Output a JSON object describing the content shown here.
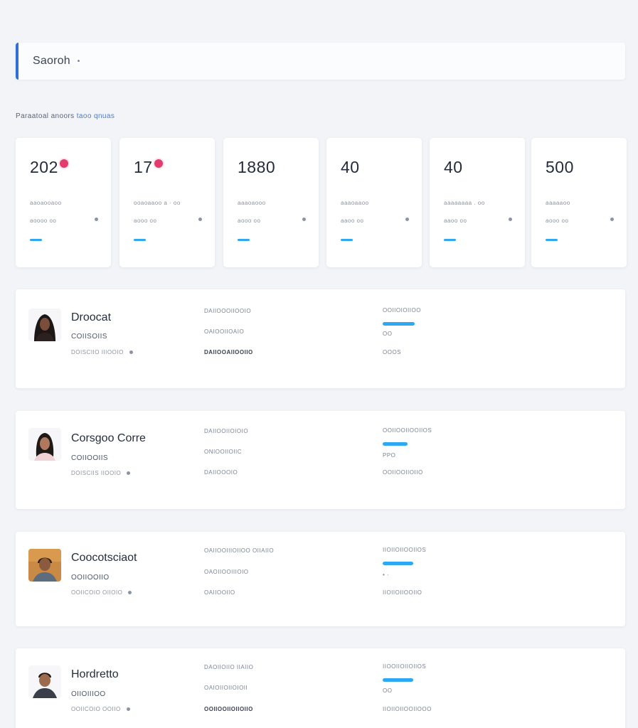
{
  "search": {
    "label": "Saoroh",
    "dot": "•"
  },
  "section": {
    "title_main": "Paraatoal anoors",
    "title_accent": "taoo qnuas"
  },
  "colors": {
    "accent_blue": "#2ea8f0",
    "badge_pink": "#e23c6f",
    "search_border": "#2f6fd6"
  },
  "stats": [
    {
      "value": "202",
      "caption": "aaoaooaoo",
      "sub": "aoooo oo",
      "bar_progress": 0.13,
      "badge": true
    },
    {
      "value": "17",
      "caption": "ooaoaaoo a · oo",
      "sub": "aooo oo",
      "bar_progress": 0.13,
      "badge": true
    },
    {
      "value": "1880",
      "caption": "aaaoaooo",
      "sub": "aooo oo",
      "bar_progress": 0.13,
      "badge": false
    },
    {
      "value": "40",
      "caption": "aaaoaaoo",
      "sub": "aaoo oo",
      "bar_progress": 0.13,
      "badge": false
    },
    {
      "value": "40",
      "caption": "aaaaaaaa . oo",
      "sub": "aaoo oo",
      "bar_progress": 0.13,
      "badge": false
    },
    {
      "value": "500",
      "caption": "aaaaaoo",
      "sub": "aooo oo",
      "bar_progress": 0.13,
      "badge": false
    }
  ],
  "people": [
    {
      "name": "Droocat",
      "role": "COIISOIIS",
      "meta": "DOISCIIO IIIOOIO",
      "col1": [
        "DAIIOOOIIOOIO",
        "OAIOOIIOAIO",
        "DAIIOOAIIOOIIO"
      ],
      "col2": [
        "OOIIOIOIIOO",
        "OO",
        "OOOS"
      ],
      "progress": 0.05,
      "avatar": "avatar-1"
    },
    {
      "name": "Corsgoo Corre",
      "role": "COIIOOIIS",
      "meta": "DOISCIIS IIOOIO",
      "col1": [
        "DAIIOOIIOIOIO",
        "ONIOOIIOIIC",
        "DAIIOOOIO"
      ],
      "col2": [
        "OOIIOOIIOOIIOS",
        "",
        "OOIIOOIIOIIO"
      ],
      "progress": 0.04,
      "avatar": "avatar-2"
    },
    {
      "name": "Coocotsciaot",
      "role": "OOIIOOIIO",
      "meta": "OOIICOIO OIIOIO",
      "col1": [
        "OAIIOOIIIOIIOO OIIAIIO",
        "OAOIIOOIIIOIO",
        "OAIIOOIIO"
      ],
      "col2": [
        "IIOIIOIIOOIIOS",
        "",
        "IIOIIOIIOOIIO"
      ],
      "progress": 0.05,
      "avatar": "avatar-3"
    },
    {
      "name": "Hordretto",
      "role": "OIIOIIIOO",
      "meta": "OOIICOIO OOIIO",
      "col1": [
        "DAOIIOIIO IIAIIO",
        "OAIOIIOIIOIOII",
        "OOIIOOIIOIIOIIO"
      ],
      "col2": [
        "IIOOIIOIIOIIOS",
        "",
        "IIOIIOIIOOIIOOO"
      ],
      "progress": 0.05,
      "avatar": "avatar-4"
    }
  ]
}
